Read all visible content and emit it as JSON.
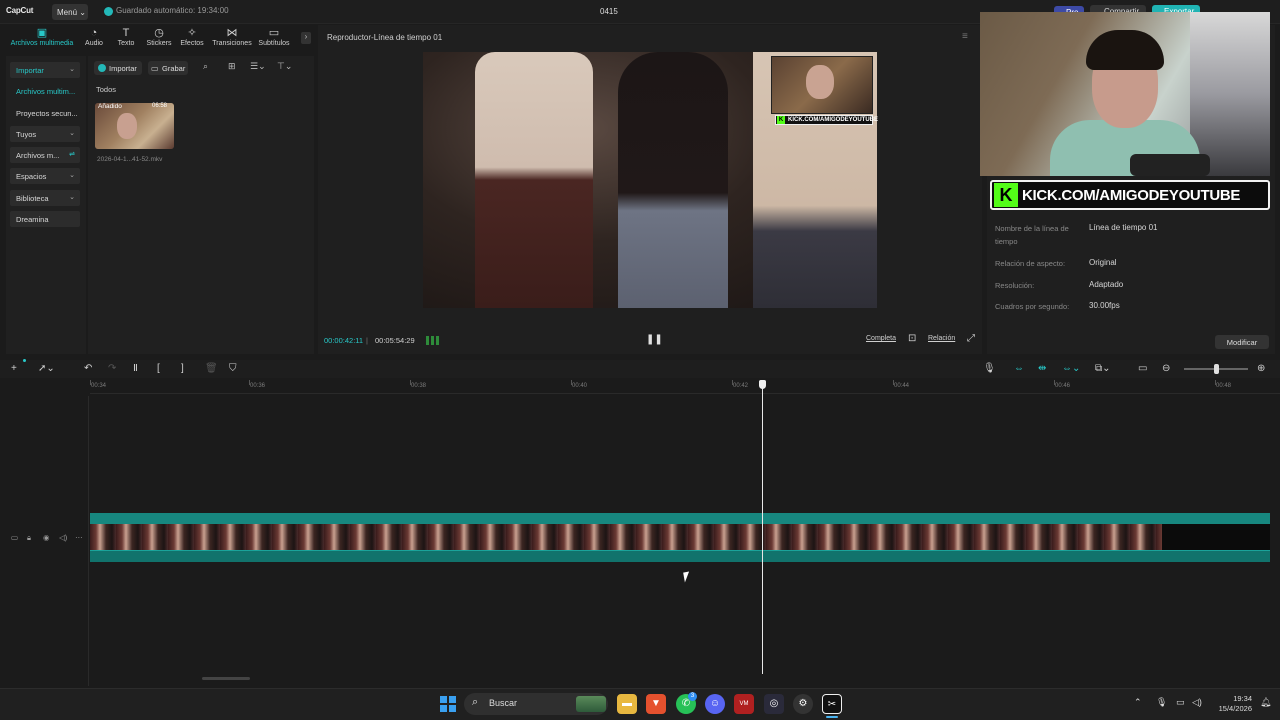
{
  "titlebar": {
    "logo": "CapCut",
    "menu_label": "Menú",
    "autosave": "Guardado automático: 19:34:00",
    "project_name": "0415",
    "pro_label": "Pro",
    "share_label": "Compartir",
    "export_label": "Exportar"
  },
  "tabs": [
    {
      "label": "Archivos multimedia",
      "icon": "media-icon"
    },
    {
      "label": "Audio",
      "icon": "audio-icon"
    },
    {
      "label": "Texto",
      "icon": "text-icon"
    },
    {
      "label": "Stickers",
      "icon": "sticker-icon"
    },
    {
      "label": "Efectos",
      "icon": "effects-icon"
    },
    {
      "label": "Transiciones",
      "icon": "transitions-icon"
    },
    {
      "label": "Subtítulos",
      "icon": "subtitles-icon"
    }
  ],
  "sidebar": {
    "items": [
      {
        "label": "Importar"
      },
      {
        "label": "Archivos multim..."
      },
      {
        "label": "Proyectos secun..."
      },
      {
        "label": "Tuyos"
      },
      {
        "label": "Archivos m..."
      },
      {
        "label": "Espacios"
      },
      {
        "label": "Biblioteca"
      },
      {
        "label": "Dreamina"
      }
    ]
  },
  "media": {
    "import_label": "Importar",
    "record_label": "Grabar",
    "filter_label": "Todos",
    "thumb_badge": "Añadido",
    "thumb_duration": "06:58",
    "thumb_name": "2026-04-1...41-52.mkv"
  },
  "player": {
    "title": "Reproductor-Línea de tiempo 01",
    "current_time": "00:00:42:11",
    "total_time": "00:05:54:29",
    "full_label": "Completa",
    "ratio_label": "Relación",
    "overlay_url": "KICK.COM/AMIGODEYOUTUBE",
    "overlay_k": "K"
  },
  "details": {
    "banner_text": "KICK.COM/AMIGODEYOUTUBE",
    "banner_k": "K",
    "rows": [
      {
        "label": "Nombre de la línea de tiempo",
        "value": "Línea de tiempo 01"
      },
      {
        "label": "Relación de aspecto:",
        "value": "Original"
      },
      {
        "label": "Resolución:",
        "value": "Adaptado"
      },
      {
        "label": "Cuadros por segundo:",
        "value": "30.00fps"
      }
    ],
    "modify_label": "Modificar"
  },
  "timeline": {
    "ticks": [
      "00:34",
      "00:36",
      "00:38",
      "00:40",
      "00:42",
      "00:44",
      "00:46",
      "00:48"
    ]
  },
  "taskbar": {
    "search_label": "Buscar",
    "time": "19:34",
    "date": "15/4/2026",
    "whatsapp_badge": "3"
  },
  "colors": {
    "accent": "#28c8c8",
    "clip": "#17877f",
    "kick_green": "#53fc18"
  }
}
